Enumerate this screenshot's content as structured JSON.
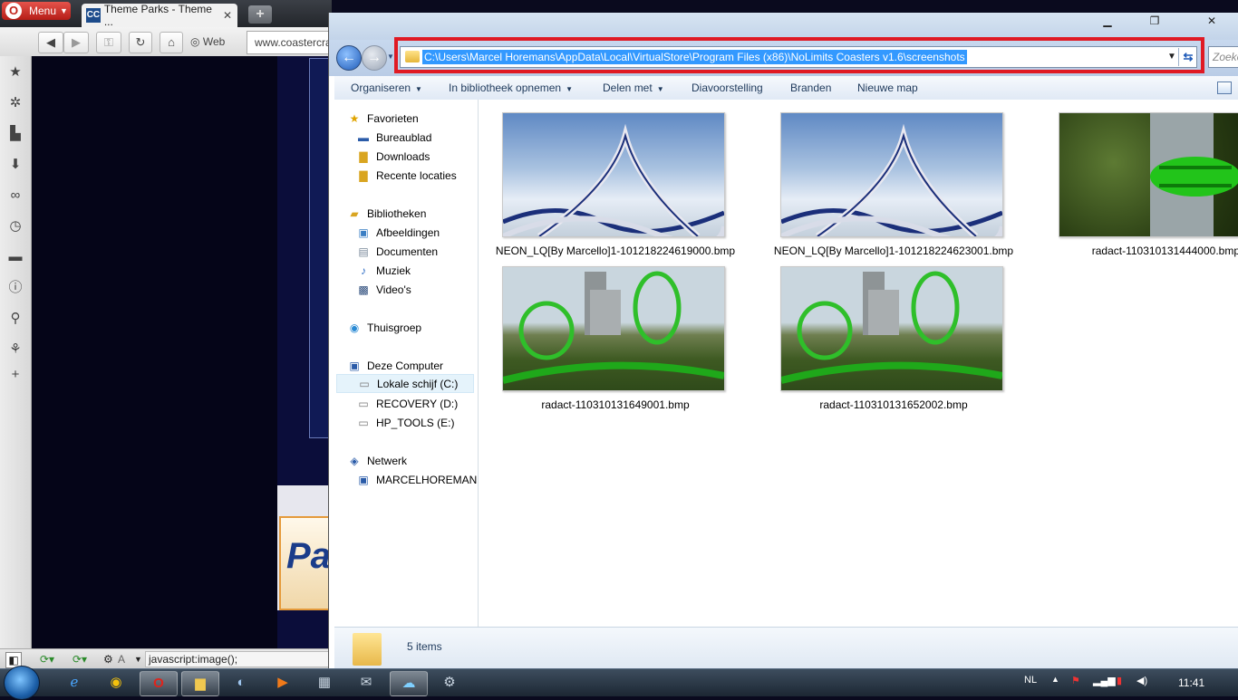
{
  "opera": {
    "menu_label": "Menu",
    "tab_title": "Theme Parks - Theme ...",
    "tab_favicon": "CC",
    "close_glyph": "✕",
    "newtab_glyph": "+",
    "search_engine_label": "Web",
    "address_text": "www.coastercra",
    "banner_text": "Pa",
    "status_text": "javascript:image();",
    "status_lang": "A"
  },
  "explorer": {
    "address_path": "C:\\Users\\Marcel Horemans\\AppData\\Local\\VirtualStore\\Program Files (x86)\\NoLimits Coasters v1.6\\screenshots",
    "search_placeholder": "Zoeken",
    "toolbar": {
      "organize": "Organiseren",
      "include_library": "In bibliotheek opnemen",
      "share": "Delen met",
      "slideshow": "Diavoorstelling",
      "burn": "Branden",
      "new_folder": "Nieuwe map"
    },
    "nav": {
      "favorites": "Favorieten",
      "desktop": "Bureaublad",
      "downloads": "Downloads",
      "recent": "Recente locaties",
      "libraries": "Bibliotheken",
      "pictures": "Afbeeldingen",
      "documents": "Documenten",
      "music": "Muziek",
      "videos": "Video's",
      "homegroup": "Thuisgroep",
      "computer": "Deze Computer",
      "drive_c": "Lokale schijf (C:)",
      "drive_d": "RECOVERY (D:)",
      "drive_e": "HP_TOOLS (E:)",
      "network": "Netwerk",
      "network_pc": "MARCELHOREMAN"
    },
    "files": [
      {
        "name": "NEON_LQ[By Marcello]1-101218224619000.bmp"
      },
      {
        "name": "NEON_LQ[By Marcello]1-101218224623001.bmp"
      },
      {
        "name": "radact-110310131444000.bmp"
      },
      {
        "name": "radact-110310131649001.bmp"
      },
      {
        "name": "radact-110310131652002.bmp"
      }
    ],
    "status_count": "5 items"
  },
  "taskbar": {
    "language": "NL",
    "clock": "11:41"
  }
}
